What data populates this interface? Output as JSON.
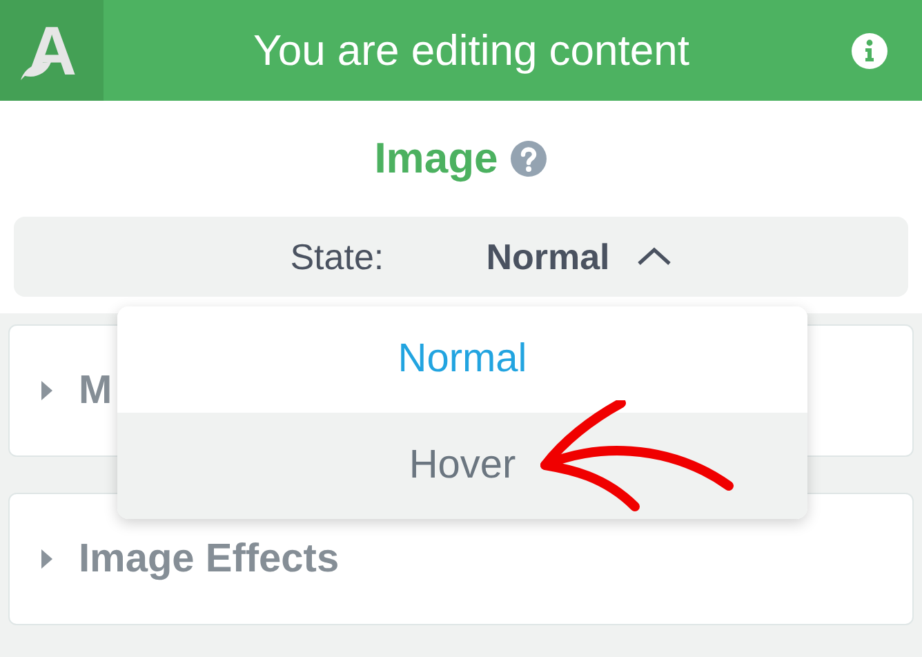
{
  "header": {
    "logo": "A",
    "title": "You are editing content"
  },
  "widget": {
    "title": "Image"
  },
  "state_select": {
    "label": "State:",
    "value": "Normal",
    "open": true,
    "options": [
      {
        "label": "Normal",
        "selected": true,
        "highlighted": false
      },
      {
        "label": "Hover",
        "selected": false,
        "highlighted": true
      }
    ]
  },
  "panels": [
    {
      "title": "M",
      "expanded": false
    },
    {
      "title": "Image Effects",
      "expanded": false
    }
  ]
}
